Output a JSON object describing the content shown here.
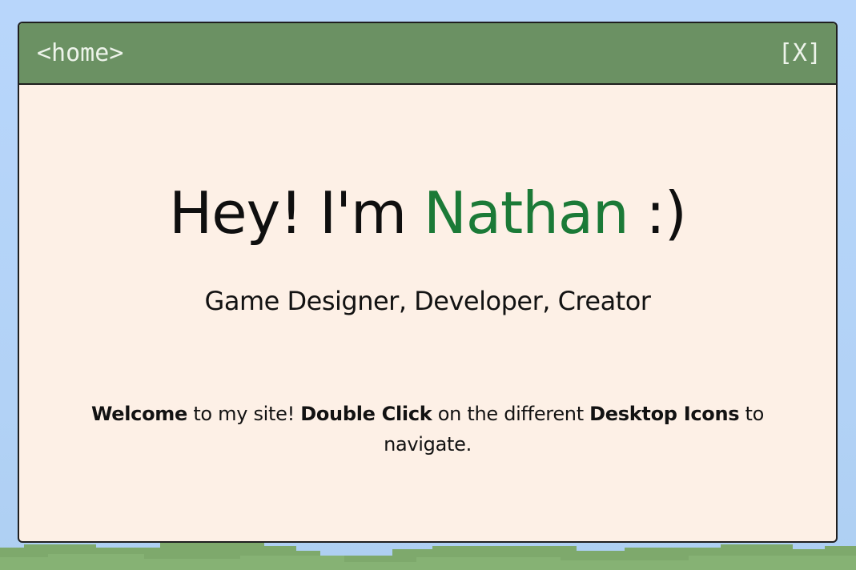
{
  "window": {
    "title": "<home>",
    "close_label": "[X]"
  },
  "hero": {
    "greeting": "Hey! I'm ",
    "name": "Nathan",
    "smile": " :)",
    "subtitle": "Game Designer, Developer, Creator"
  },
  "welcome": {
    "part1_bold": "Welcome",
    "part2": " to my site! ",
    "part3_bold": "Double Click",
    "part4": " on the different ",
    "part5_bold": "Desktop Icons",
    "part6": " to navigate."
  },
  "colors": {
    "sky": "#b8d6fb",
    "titlebar": "#6b9163",
    "window_bg": "#fdf0e6",
    "name_accent": "#1b7a37",
    "grass": "#7ea96c"
  }
}
